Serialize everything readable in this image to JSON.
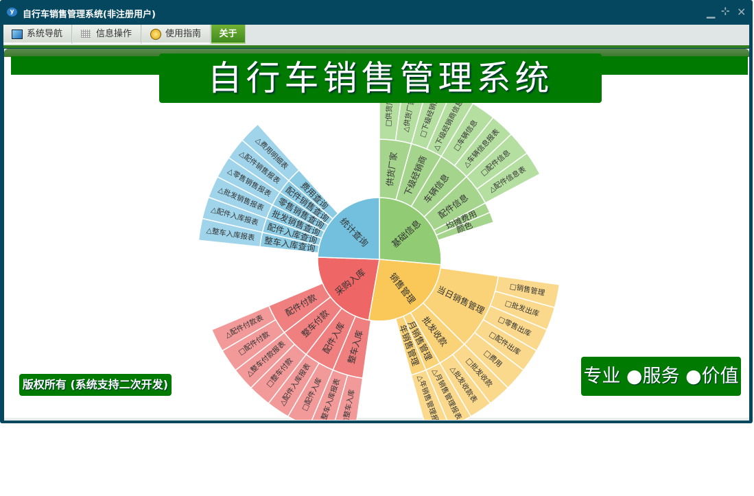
{
  "window": {
    "title": "自行车销售管理系统(非注册用户)",
    "app_icon": "y",
    "controls": [
      "minimize-icon",
      "restore-icon",
      "close-icon"
    ]
  },
  "tabs": [
    {
      "label": "系统导航",
      "icon": "monitor-icon"
    },
    {
      "label": "信息操作",
      "icon": "grid-icon"
    },
    {
      "label": "使用指南",
      "icon": "help-icon"
    },
    {
      "label": "关于",
      "active": true
    }
  ],
  "banner": {
    "title": "自行车销售管理系统"
  },
  "footer": {
    "copyright": "版权所有 (系统支持二次开发)",
    "slogan": "专业 ●服务 ●价值"
  },
  "colors": {
    "frame": "#04475f",
    "brand_green": "#007a00"
  },
  "chart_data": {
    "type": "sunburst",
    "series": [
      {
        "name": "基础信息",
        "colors": [
          "#91cc75",
          "#a5d58d",
          "#b5dea1"
        ],
        "children": [
          {
            "name": "供货厂家",
            "children": [
              "□供货厂家",
              "△供货厂家表"
            ]
          },
          {
            "name": "下级经销商",
            "children": [
              "□下级经销商",
              "△下级经销商信息"
            ]
          },
          {
            "name": "车辆信息",
            "children": [
              "□车辆信息",
              "△车辆信息报表"
            ]
          },
          {
            "name": "配件信息",
            "children": [
              "□配件信息",
              "△配件信息表"
            ]
          },
          {
            "name": "均摊费用",
            "children": []
          },
          {
            "name": "颜色",
            "children": []
          }
        ]
      },
      {
        "name": "销售管理",
        "colors": [
          "#fac858",
          "#fad277",
          "#fbd98c"
        ],
        "children": [
          {
            "name": "当日销售管理",
            "children": [
              "□销售管理",
              "□批发出库",
              "□零售出库",
              "□配件出库",
              "□费用"
            ]
          },
          {
            "name": "批发收款",
            "children": [
              "□批发收款",
              "△批发收款表"
            ]
          },
          {
            "name": "月销售管理",
            "children": [
              "△月销售管理报表"
            ]
          },
          {
            "name": "年销售管理",
            "children": [
              "△年销售管理报表"
            ]
          }
        ]
      },
      {
        "name": "采购入库",
        "colors": [
          "#ee6666",
          "#f07f7f",
          "#f29999"
        ],
        "children": [
          {
            "name": "整车入库",
            "children": [
              "□整车入库",
              "△整车入库报表"
            ]
          },
          {
            "name": "配件入库",
            "children": [
              "□配件入库",
              "△配件入库报表"
            ]
          },
          {
            "name": "整车付款",
            "children": [
              "□整车付款",
              "△整车付款报表"
            ]
          },
          {
            "name": "配件付款",
            "children": [
              "□配件付款",
              "△配件付款表"
            ]
          }
        ]
      },
      {
        "name": "统计查询",
        "colors": [
          "#73c0de",
          "#8bcbe4",
          "#9fd4ea"
        ],
        "children": [
          {
            "name": "整车入库查询",
            "children": [
              "△整车入库报表"
            ]
          },
          {
            "name": "配件入库查询",
            "children": [
              "△配件入库报表"
            ]
          },
          {
            "name": "批发销售查询",
            "children": [
              "△批发销售报表"
            ]
          },
          {
            "name": "零售销售查询",
            "children": [
              "△零售销售报表"
            ]
          },
          {
            "name": "配件销售查询",
            "children": [
              "△配件销售报表"
            ]
          },
          {
            "name": "费用查询",
            "children": [
              "△费用明细表"
            ]
          }
        ]
      }
    ]
  }
}
